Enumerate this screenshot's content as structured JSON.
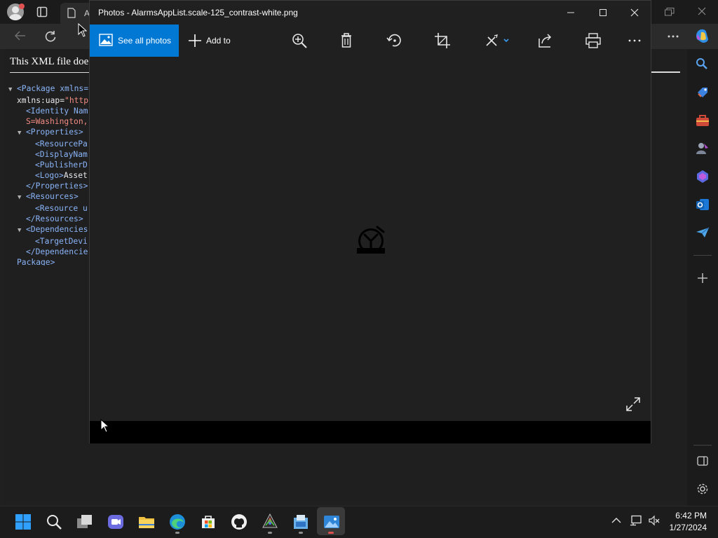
{
  "browser": {
    "tab_title_partial": "A",
    "xml_heading": "This XML file does not appear to have any style information associated with it. The document tree is shown below.",
    "xml_lines": [
      {
        "tri": "▼",
        "indent": 0,
        "tag": "<Package xmlns=",
        "attr": "",
        "val": "",
        "txt": ""
      },
      {
        "tri": "",
        "indent": 0,
        "tag": "",
        "attr": "xmlns:uap=",
        "val": "\"http",
        "txt": ""
      },
      {
        "tri": "",
        "indent": 1,
        "tag": "<Identity Nam",
        "attr": "",
        "val": "",
        "txt": ""
      },
      {
        "tri": "",
        "indent": 1,
        "tag": "",
        "attr": "",
        "val": "S=Washington,",
        "txt": ""
      },
      {
        "tri": "▼",
        "indent": 1,
        "tag": "<Properties>",
        "attr": "",
        "val": "",
        "txt": ""
      },
      {
        "tri": "",
        "indent": 2,
        "tag": "<ResourcePa",
        "attr": "",
        "val": "",
        "txt": ""
      },
      {
        "tri": "",
        "indent": 2,
        "tag": "<DisplayNam",
        "attr": "",
        "val": "",
        "txt": ""
      },
      {
        "tri": "",
        "indent": 2,
        "tag": "<PublisherD",
        "attr": "",
        "val": "",
        "txt": ""
      },
      {
        "tri": "",
        "indent": 2,
        "tag": "<Logo>",
        "attr": "",
        "val": "",
        "txt": "Asset"
      },
      {
        "tri": "",
        "indent": 1,
        "tag": "</Properties>",
        "attr": "",
        "val": "",
        "txt": ""
      },
      {
        "tri": "▼",
        "indent": 1,
        "tag": "<Resources>",
        "attr": "",
        "val": "",
        "txt": ""
      },
      {
        "tri": "",
        "indent": 2,
        "tag": "<Resource u",
        "attr": "",
        "val": "",
        "txt": ""
      },
      {
        "tri": "",
        "indent": 1,
        "tag": "</Resources>",
        "attr": "",
        "val": "",
        "txt": ""
      },
      {
        "tri": "▼",
        "indent": 1,
        "tag": "<Dependencies",
        "attr": "",
        "val": "",
        "txt": ""
      },
      {
        "tri": "",
        "indent": 2,
        "tag": "<TargetDevi",
        "attr": "",
        "val": "",
        "txt": ""
      },
      {
        "tri": "",
        "indent": 1,
        "tag": "</Dependencie",
        "attr": "",
        "val": "",
        "txt": ""
      },
      {
        "tri": "",
        "indent": 0,
        "tag": "Package>",
        "attr": "",
        "val": "",
        "txt": ""
      }
    ],
    "sidebar_icons": [
      "search-icon",
      "tag-icon",
      "toolbox-icon",
      "people-icon",
      "copilot-icon",
      "outlook-icon",
      "send-icon",
      "add-icon",
      "split-screen-icon",
      "settings-icon"
    ]
  },
  "photos": {
    "title": "Photos - AlarmsAppList.scale-125_contrast-white.png",
    "see_all_label": "See all photos",
    "add_to_label": "Add to",
    "commands": [
      "zoom-in-icon",
      "delete-icon",
      "rotate-icon",
      "crop-icon",
      "edit-icon",
      "share-icon",
      "print-icon",
      "more-icon"
    ],
    "more_label": "···",
    "accent": "#0078d4"
  },
  "taskbar": {
    "apps": [
      "start-icon",
      "search-icon",
      "file-explorer-icon",
      "teams-icon",
      "folder-icon",
      "edge-icon",
      "store-icon",
      "github-icon",
      "inkscape-icon",
      "app-icon",
      "photos-icon"
    ],
    "time": "6:42 PM",
    "date": "1/27/2024"
  }
}
